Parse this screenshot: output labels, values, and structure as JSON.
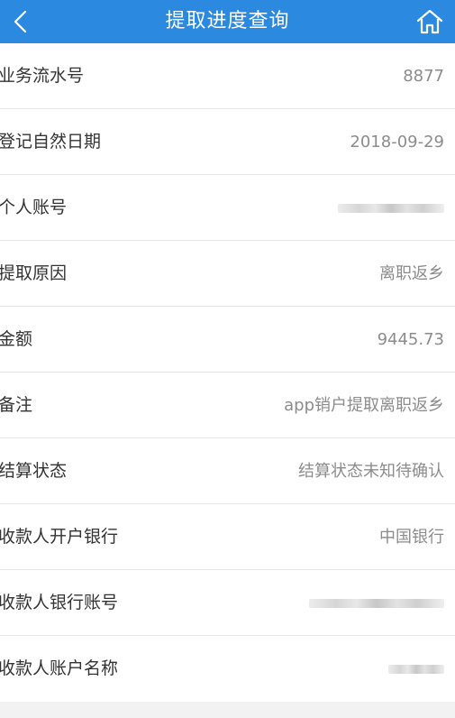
{
  "header": {
    "title": "提取进度查询",
    "back_icon": "chevron-left-icon",
    "home_icon": "home-icon",
    "bg_color": "#2b8ae0"
  },
  "rows": [
    {
      "label": "业务流水号",
      "value": "8877",
      "masked": false
    },
    {
      "label": "登记自然日期",
      "value": "2018-09-29",
      "masked": false
    },
    {
      "label": "个人账号",
      "value": "",
      "masked": true
    },
    {
      "label": "提取原因",
      "value": "离职返乡",
      "masked": false
    },
    {
      "label": "金额",
      "value": "9445.73",
      "masked": false
    },
    {
      "label": "备注",
      "value": "app销户提取离职返乡",
      "masked": false
    },
    {
      "label": "结算状态",
      "value": "结算状态未知待确认",
      "masked": false
    },
    {
      "label": "收款人开户银行",
      "value": "中国银行",
      "masked": false
    },
    {
      "label": "收款人银行账号",
      "value": "",
      "masked": true
    },
    {
      "label": "收款人账户名称",
      "value": "",
      "masked": true
    }
  ]
}
